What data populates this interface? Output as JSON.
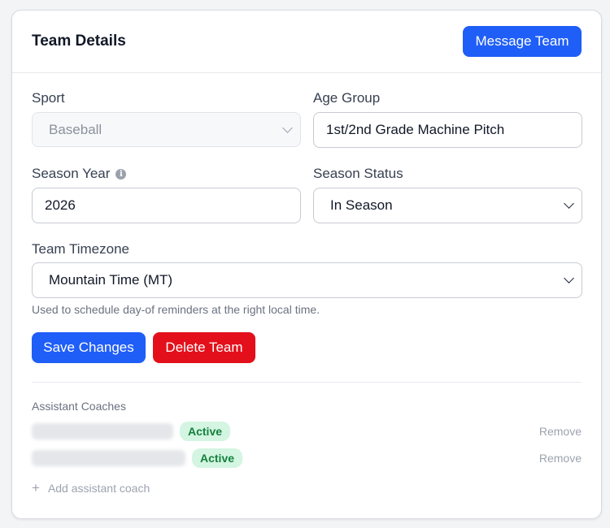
{
  "header": {
    "title": "Team Details",
    "message_button": "Message Team"
  },
  "form": {
    "sport": {
      "label": "Sport",
      "value": "Baseball"
    },
    "age_group": {
      "label": "Age Group",
      "value": "1st/2nd Grade Machine Pitch"
    },
    "season_year": {
      "label": "Season Year",
      "value": "2026",
      "info_icon": "info-icon"
    },
    "season_status": {
      "label": "Season Status",
      "value": "In Season"
    },
    "timezone": {
      "label": "Team Timezone",
      "value": "Mountain Time (MT)",
      "help": "Used to schedule day-of reminders at the right local time."
    }
  },
  "actions": {
    "save_label": "Save Changes",
    "delete_label": "Delete Team"
  },
  "assistant_coaches": {
    "title": "Assistant Coaches",
    "items": [
      {
        "status": "Active",
        "remove_label": "Remove"
      },
      {
        "status": "Active",
        "remove_label": "Remove"
      }
    ],
    "add_label": "Add assistant coach"
  },
  "colors": {
    "primary": "#1f5ef7",
    "danger": "#e3101b",
    "active_badge_bg": "#d3f5e1",
    "active_badge_text": "#15803d"
  }
}
